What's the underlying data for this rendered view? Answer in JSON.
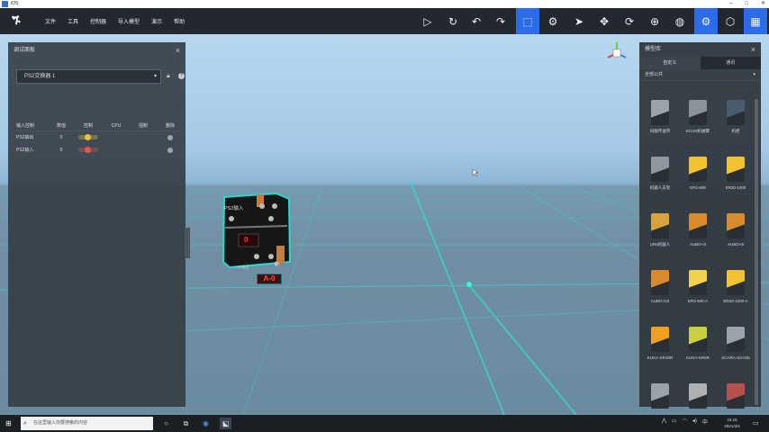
{
  "window": {
    "title": "iOS"
  },
  "toolbar": {
    "menu": [
      "文件",
      "工具",
      "控制器",
      "导入模型",
      "演示",
      "帮助"
    ],
    "icons": [
      {
        "name": "play-icon",
        "glyph": "▷"
      },
      {
        "name": "refresh-icon",
        "glyph": "↻"
      },
      {
        "name": "undo-icon",
        "glyph": "↶"
      },
      {
        "name": "redo-icon",
        "glyph": "↷"
      },
      {
        "name": "cursor-select-icon",
        "glyph": "⬚",
        "active": true
      },
      {
        "name": "robot-teach-icon",
        "glyph": "⚙"
      },
      {
        "name": "pointer-icon",
        "glyph": "➤"
      },
      {
        "name": "move-icon",
        "glyph": "✥"
      },
      {
        "name": "rotate-icon",
        "glyph": "⟳"
      },
      {
        "name": "target-icon",
        "glyph": "⊕"
      },
      {
        "name": "globe-icon",
        "glyph": "◍"
      },
      {
        "name": "settings-icon",
        "glyph": "⚙",
        "active": true
      },
      {
        "name": "cube-icon",
        "glyph": "⬡"
      },
      {
        "name": "grid-icon",
        "glyph": "▦",
        "active": true
      }
    ]
  },
  "left_panel": {
    "title": "调试面板",
    "device_select": "PS2交换器 1",
    "columns": [
      "输入控制",
      "数值",
      "控制",
      "CPU",
      "强制",
      "删除"
    ],
    "rows": [
      {
        "name": "PS2输出",
        "value": "0",
        "toggle_color": "#e6c23a"
      },
      {
        "name": "PS2输入",
        "value": "0",
        "toggle_color": "#e05a4a"
      }
    ]
  },
  "right_panel": {
    "title": "模型库",
    "tabs": [
      "自定义",
      "通讯"
    ],
    "category": "全部公共",
    "models": [
      {
        "label": "伺服传送带",
        "color": "#9aa2aa"
      },
      {
        "label": "ECI20机械臂",
        "color": "#8a929a"
      },
      {
        "label": "机柜",
        "color": "#4a5b6d"
      },
      {
        "label": "机器人支架",
        "color": "#8e969e"
      },
      {
        "label": "ER3-600",
        "color": "#f2c230"
      },
      {
        "label": "ER20-1000",
        "color": "#f2c230"
      },
      {
        "label": "UR5机器人",
        "color": "#d9a23a"
      },
      {
        "label": "AUBO-I3",
        "color": "#d98a2a"
      },
      {
        "label": "AUBO-I5",
        "color": "#d98a2a"
      },
      {
        "label": "AUBO-I10",
        "color": "#d98a2a"
      },
      {
        "label": "ER3-600-A",
        "color": "#f2d24a"
      },
      {
        "label": "ER20-1000-A",
        "color": "#f2c230"
      },
      {
        "label": "KUKA-KR10R",
        "color": "#f0a020"
      },
      {
        "label": "KUKA-KR6R",
        "color": "#c8d040"
      },
      {
        "label": "SCARA-S3-045",
        "color": "#9aa2aa"
      },
      {
        "label": "",
        "color": "#9aa2aa"
      },
      {
        "label": "",
        "color": "#b0b0b0"
      },
      {
        "label": "",
        "color": "#b85050"
      }
    ]
  },
  "device": {
    "label": "PS2输入",
    "display_value": "0",
    "bottom_label": "PS2输出",
    "tag": "A-0"
  },
  "taskbar": {
    "search_placeholder": "在这里输入你要搜索的内容",
    "time": "15:15",
    "date": "2021/3/4"
  }
}
